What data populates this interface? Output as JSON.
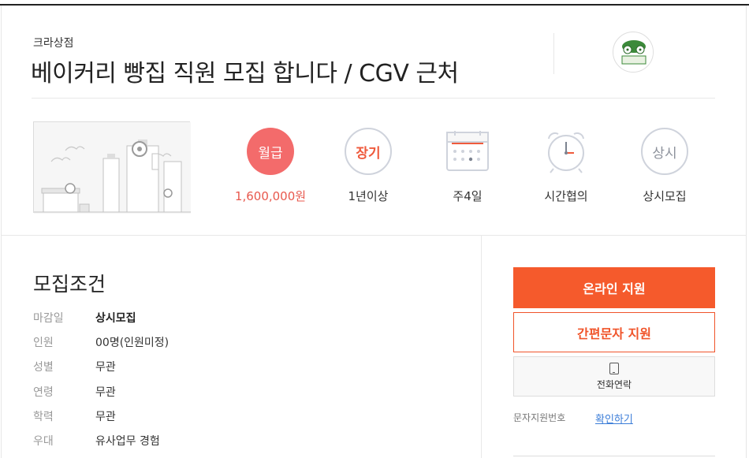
{
  "header": {
    "company": "크라상점",
    "title": "베이커리 빵집 직원 모집 합니다 / CGV 근처",
    "logo_text": "크라상점"
  },
  "summary": [
    {
      "icon": "won-circle",
      "badge": "월급",
      "label": "1,600,000원"
    },
    {
      "icon": "long-term-circle",
      "badge": "장기",
      "label": "1년이상"
    },
    {
      "icon": "calendar-icon",
      "badge": "",
      "label": "주4일"
    },
    {
      "icon": "alarm-clock-icon",
      "badge": "",
      "label": "시간협의"
    },
    {
      "icon": "always-circle",
      "badge": "상시",
      "label": "상시모집"
    }
  ],
  "conditions": {
    "title": "모집조건",
    "rows": [
      {
        "key": "마감일",
        "value": "상시모집"
      },
      {
        "key": "인원",
        "value": "00명(인원미정)"
      },
      {
        "key": "성별",
        "value": "무관"
      },
      {
        "key": "연령",
        "value": "무관"
      },
      {
        "key": "학력",
        "value": "무관"
      },
      {
        "key": "우대",
        "value": "유사업무 경험"
      }
    ]
  },
  "actions": {
    "online": "온라인 지원",
    "sms": "간편문자 지원",
    "phone": "전화연락",
    "sms_number_label": "문자지원번호",
    "sms_check": "확인하기"
  },
  "colors": {
    "accent": "#f55a2c",
    "salary_red": "#f36b6b",
    "link_blue": "#3b7dd8"
  }
}
